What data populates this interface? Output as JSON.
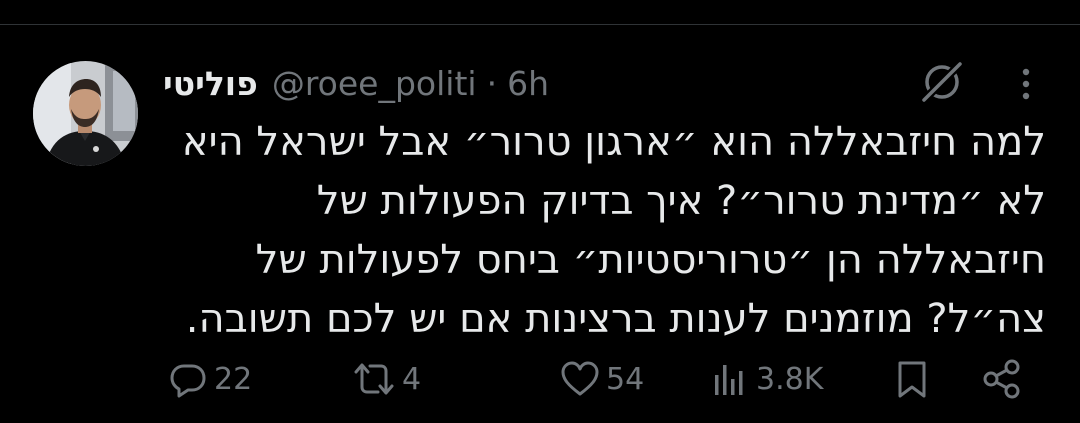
{
  "tweet": {
    "author": {
      "display_name": "פוליטי",
      "handle": "@roee_politi",
      "separator": "·",
      "time": "6h"
    },
    "text_lines": [
      "למה חיזבאללה הוא ״ארגון טרור״ אבל ישראל היא",
      "לא ״מדינת טרור״? איך בדיוק הפעולות של",
      "חיזבאללה הן ״טרוריסטיות״ ביחס לפעולות של",
      "צה״ל? מוזמנים לענות ברצינות אם יש לכם תשובה."
    ]
  },
  "actions": {
    "reply": {
      "icon": "reply-icon",
      "count": "22"
    },
    "repost": {
      "icon": "repost-icon",
      "count": "4"
    },
    "like": {
      "icon": "heart-icon",
      "count": "54"
    },
    "views": {
      "icon": "views-chart-icon",
      "count": "3.8K"
    },
    "bookmark": {
      "icon": "bookmark-icon"
    },
    "share": {
      "icon": "share-icon"
    }
  },
  "colors": {
    "background": "#000000",
    "text": "#e7e9ea",
    "muted": "#71767b",
    "divider": "#2f3336"
  }
}
